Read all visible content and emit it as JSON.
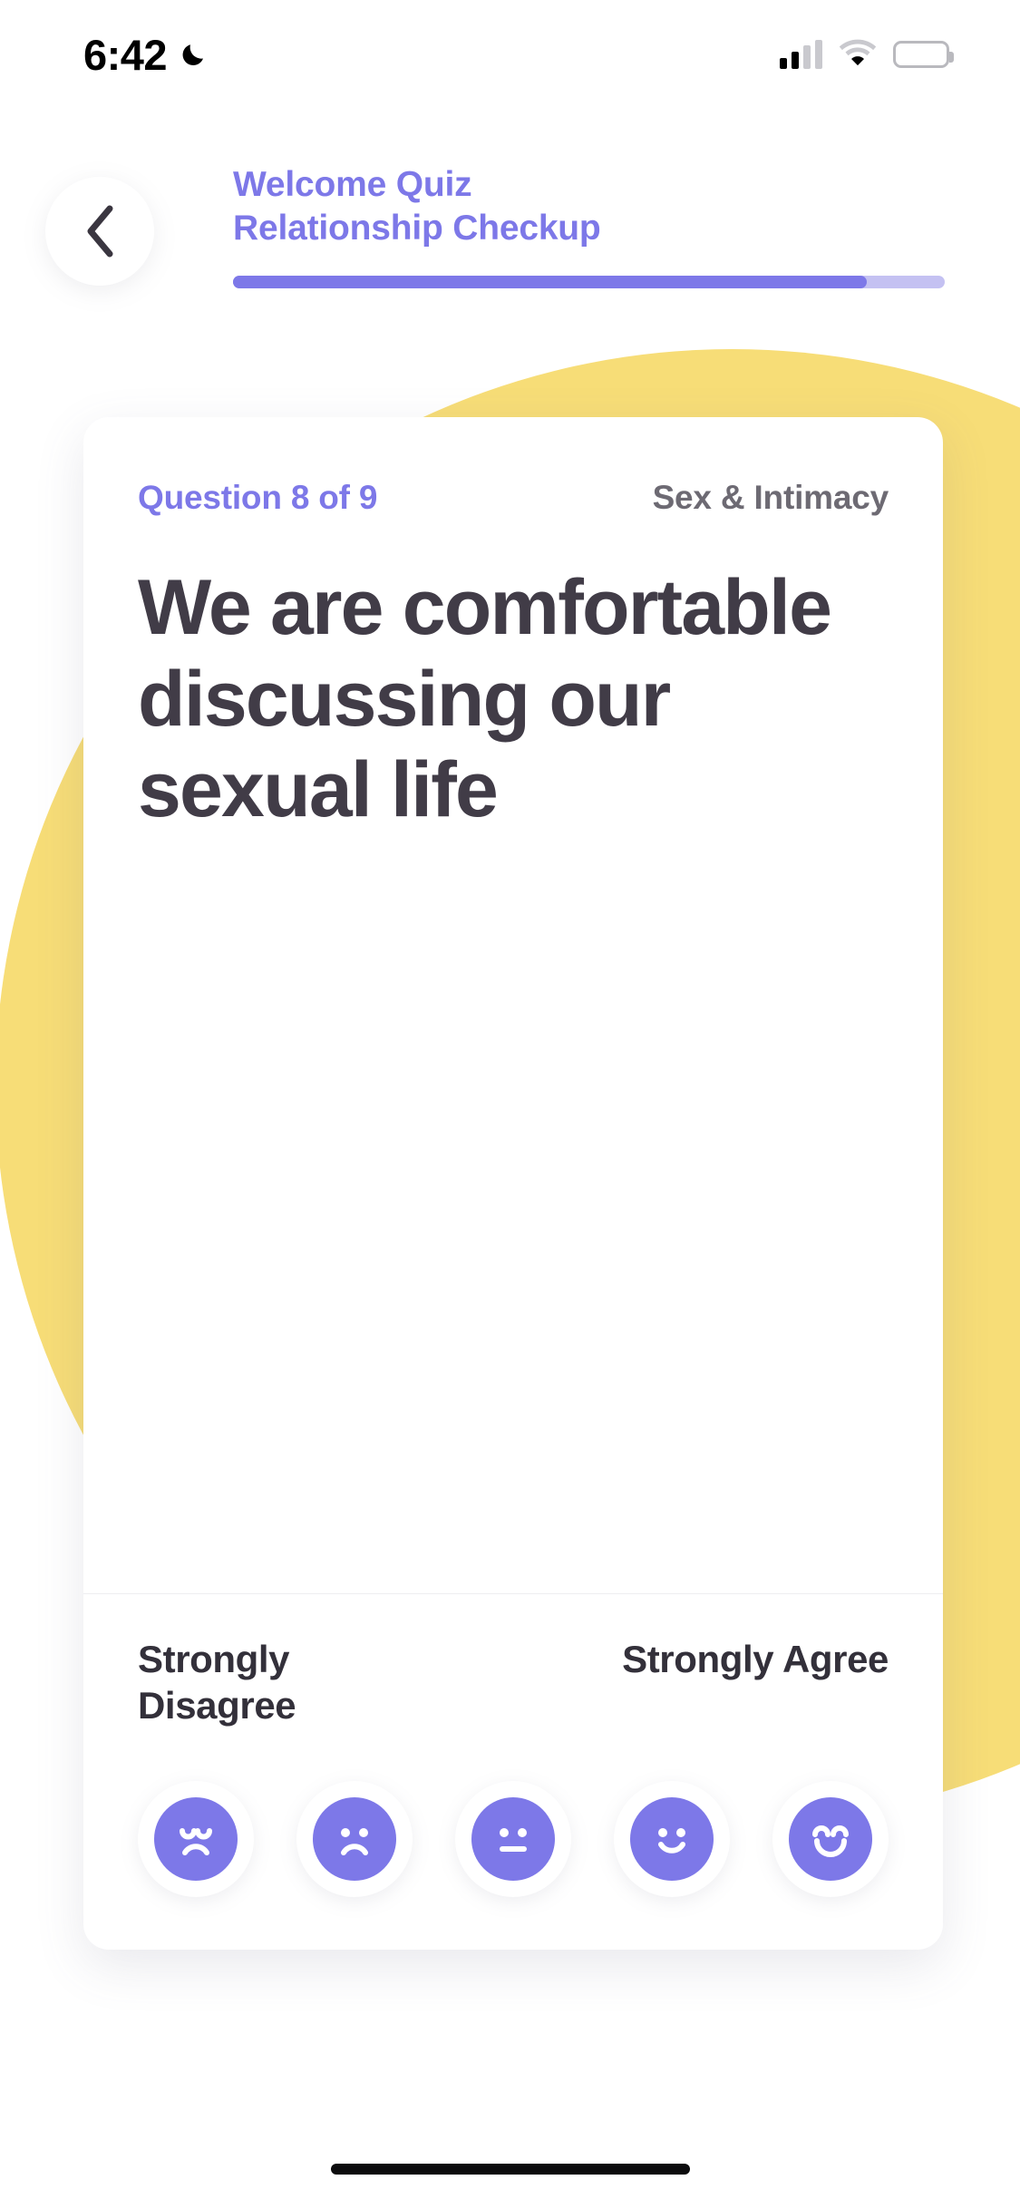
{
  "status_bar": {
    "time": "6:42",
    "moon_icon": "crescent-moon-icon",
    "signal_icon": "cellular-signal-icon",
    "wifi_icon": "wifi-icon",
    "battery_icon": "battery-icon"
  },
  "header": {
    "back_icon": "chevron-left-icon",
    "title_line_1": "Welcome Quiz",
    "title_line_2": "Relationship Checkup",
    "accent_color": "#7d78e8",
    "progress": {
      "percent": 89,
      "track_color": "#c4c1f2",
      "fill_color": "#7d78e8"
    }
  },
  "decor": {
    "circle_color": "#f7dd77"
  },
  "card": {
    "question_counter": "Question 8 of 9",
    "category": "Sex & Intimacy",
    "question_text": "We are comfortable discussing our sexual life",
    "text_color": "#413c47",
    "scale": {
      "low_label": "Strongly Disagree",
      "high_label": "Strongly Agree",
      "options": [
        {
          "value": 1,
          "icon": "face-very-sad-icon",
          "label": "Strongly Disagree"
        },
        {
          "value": 2,
          "icon": "face-sad-icon",
          "label": "Disagree"
        },
        {
          "value": 3,
          "icon": "face-neutral-icon",
          "label": "Neutral"
        },
        {
          "value": 4,
          "icon": "face-happy-icon",
          "label": "Agree"
        },
        {
          "value": 5,
          "icon": "face-very-happy-icon",
          "label": "Strongly Agree"
        }
      ],
      "face_color": "#7d78e8"
    }
  },
  "home_indicator": "home-indicator"
}
